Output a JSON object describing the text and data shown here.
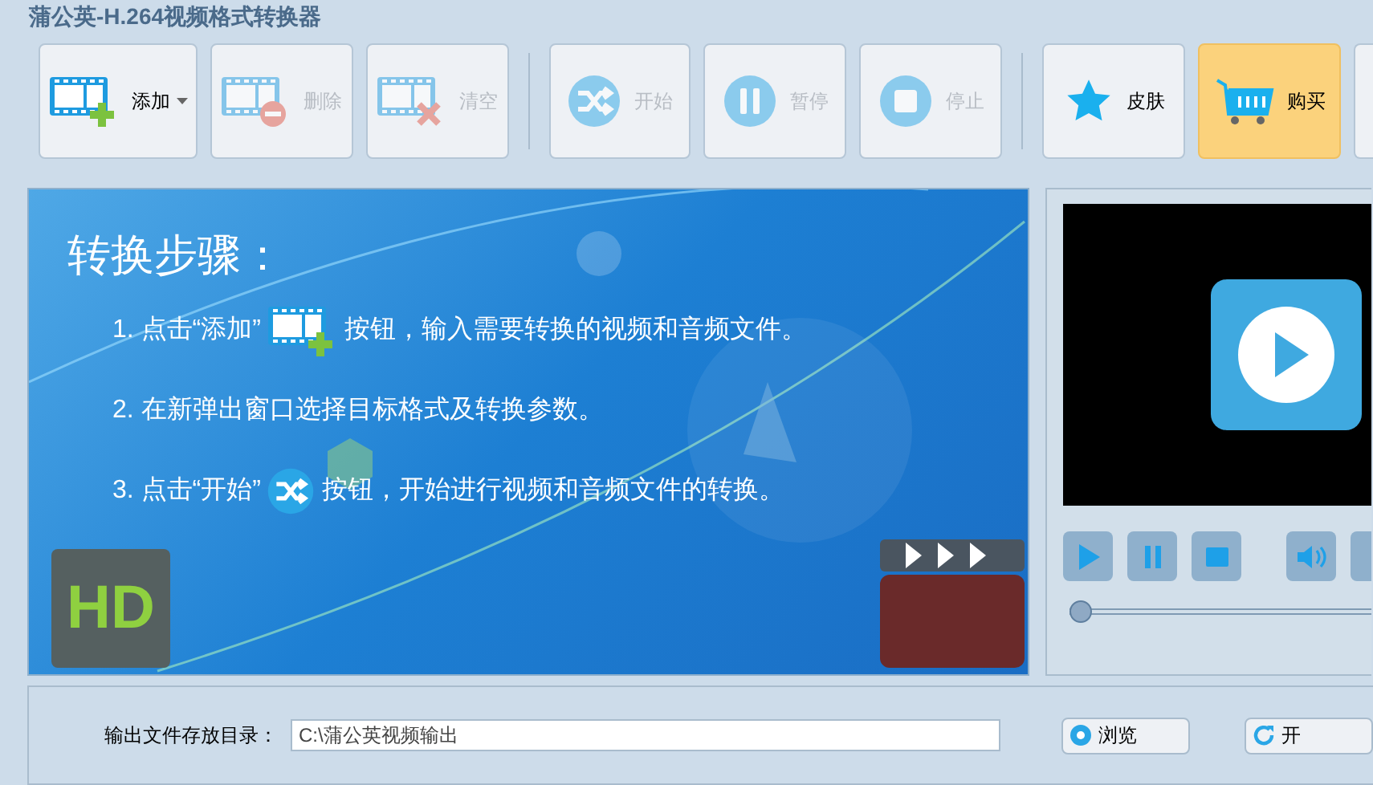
{
  "window": {
    "title": "蒲公英-H.264视频格式转换器"
  },
  "toolbar": [
    {
      "kind": "add",
      "label": "添加",
      "disabled": false,
      "highlighted": false,
      "dropdown": true
    },
    {
      "kind": "delete",
      "label": "删除",
      "disabled": true,
      "highlighted": false,
      "dropdown": false
    },
    {
      "kind": "clear",
      "label": "清空",
      "disabled": true,
      "highlighted": false,
      "dropdown": false
    },
    {
      "kind": "separator"
    },
    {
      "kind": "start",
      "label": "开始",
      "disabled": true,
      "highlighted": false,
      "dropdown": false
    },
    {
      "kind": "pause",
      "label": "暂停",
      "disabled": true,
      "highlighted": false,
      "dropdown": false
    },
    {
      "kind": "stop",
      "label": "停止",
      "disabled": true,
      "highlighted": false,
      "dropdown": false
    },
    {
      "kind": "separator"
    },
    {
      "kind": "skin",
      "label": "皮肤",
      "disabled": false,
      "highlighted": false,
      "dropdown": false
    },
    {
      "kind": "buy",
      "label": "购买",
      "disabled": false,
      "highlighted": true,
      "dropdown": false
    },
    {
      "kind": "partial"
    }
  ],
  "banner": {
    "heading": "转换步骤：",
    "steps": [
      {
        "kind": "add",
        "before": "1. 点击“添加”",
        "after": "按钮，输入需要转换的视频和音频文件。"
      },
      {
        "kind": "plain",
        "before": "2. 在新弹出窗口选择目标格式及转换参数。"
      },
      {
        "kind": "start",
        "before": "3. 点击“开始”",
        "after": "按钮，开始进行视频和音频文件的转换。"
      }
    ],
    "hd_badge": "HD"
  },
  "player": {
    "controls": [
      {
        "kind": "play"
      },
      {
        "kind": "pause"
      },
      {
        "kind": "stop"
      },
      {
        "kind": "volume"
      },
      {
        "kind": "partial"
      }
    ],
    "seek": {
      "level": 0.0
    }
  },
  "output": {
    "label": "输出文件存放目录：",
    "value": "C:\\蒲公英视频输出",
    "buttons": [
      {
        "kind": "browse",
        "label": "浏览"
      },
      {
        "kind": "open",
        "label": "开"
      }
    ]
  }
}
